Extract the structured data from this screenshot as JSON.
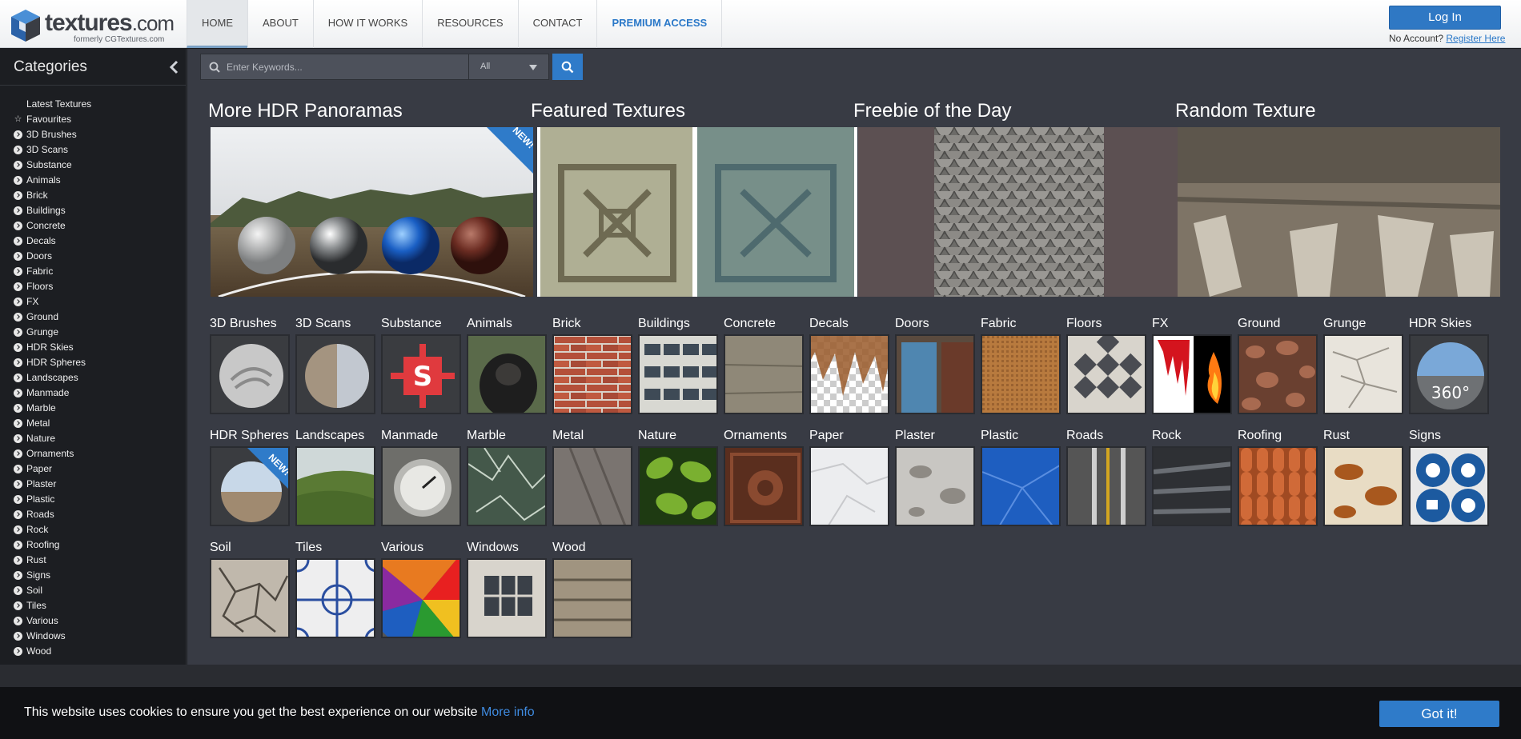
{
  "header": {
    "logo_main": "textures",
    "logo_tld": ".com",
    "logo_sub": "formerly CGTextures.com",
    "nav": [
      {
        "label": "HOME",
        "name": "nav-home"
      },
      {
        "label": "ABOUT",
        "name": "nav-about"
      },
      {
        "label": "HOW IT WORKS",
        "name": "nav-how-it-works"
      },
      {
        "label": "RESOURCES",
        "name": "nav-resources"
      },
      {
        "label": "CONTACT",
        "name": "nav-contact"
      },
      {
        "label": "PREMIUM ACCESS",
        "name": "nav-premium-access"
      }
    ],
    "login_label": "Log In",
    "no_account": "No Account?",
    "register_label": "Register Here"
  },
  "sidebar": {
    "title": "Categories",
    "items": [
      "Latest Textures",
      "Favourites",
      "3D Brushes",
      "3D Scans",
      "Substance",
      "Animals",
      "Brick",
      "Buildings",
      "Concrete",
      "Decals",
      "Doors",
      "Fabric",
      "Floors",
      "FX",
      "Ground",
      "Grunge",
      "HDR Skies",
      "HDR Spheres",
      "Landscapes",
      "Manmade",
      "Marble",
      "Metal",
      "Nature",
      "Ornaments",
      "Paper",
      "Plaster",
      "Plastic",
      "Roads",
      "Rock",
      "Roofing",
      "Rust",
      "Signs",
      "Soil",
      "Tiles",
      "Various",
      "Windows",
      "Wood"
    ]
  },
  "search": {
    "placeholder": "Enter Keywords...",
    "filter_value": "All"
  },
  "featured": {
    "hdr": "More HDR Panoramas",
    "featured": "Featured Textures",
    "freebie": "Freebie of the Day",
    "random": "Random Texture",
    "new_badge": "NEW!"
  },
  "categories": [
    "3D Brushes",
    "3D Scans",
    "Substance",
    "Animals",
    "Brick",
    "Buildings",
    "Concrete",
    "Decals",
    "Doors",
    "Fabric",
    "Floors",
    "FX",
    "Ground",
    "Grunge",
    "HDR Skies",
    "HDR Spheres",
    "Landscapes",
    "Manmade",
    "Marble",
    "Metal",
    "Nature",
    "Ornaments",
    "Paper",
    "Plaster",
    "Plastic",
    "Roads",
    "Rock",
    "Roofing",
    "Rust",
    "Signs",
    "Soil",
    "Tiles",
    "Various",
    "Windows",
    "Wood"
  ],
  "thumb_text": {
    "hdr_skies": "360°"
  },
  "cookie": {
    "text": "This website uses cookies to ensure you get the best experience on our website",
    "more_info": "More info",
    "button": "Got it!"
  },
  "colors": {
    "accent_blue": "#2f7bc9",
    "main_bg": "#383b44",
    "sidebar_bg": "#1c1e22"
  }
}
